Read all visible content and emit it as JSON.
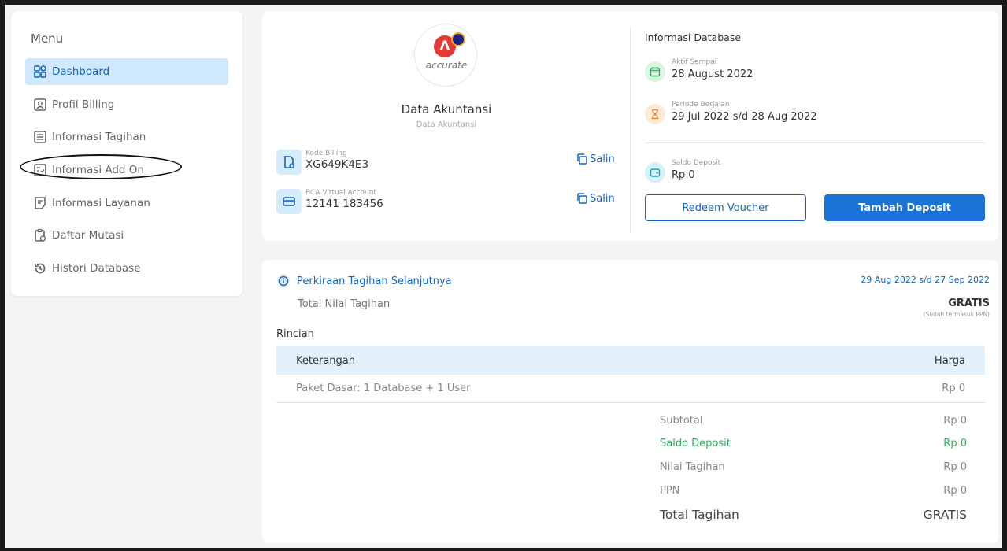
{
  "sidebar": {
    "title": "Menu",
    "items": [
      {
        "label": "Dashboard"
      },
      {
        "label": "Profil Billing"
      },
      {
        "label": "Informasi Tagihan"
      },
      {
        "label": "Informasi Add On"
      },
      {
        "label": "Informasi Layanan"
      },
      {
        "label": "Daftar Mutasi"
      },
      {
        "label": "Histori Database"
      }
    ]
  },
  "database": {
    "logo_text": "accurate",
    "name": "Data Akuntansi",
    "subtitle": "Data Akuntansi",
    "billing_code_label": "Kode Billing",
    "billing_code": "XG649K4E3",
    "va_label": "BCA Virtual Account",
    "va_number": "12141 183456",
    "copy_label": "Salin"
  },
  "db_info": {
    "title": "Informasi Database",
    "active_until_label": "Aktif Sampai",
    "active_until": "28 August 2022",
    "period_label": "Periode Berjalan",
    "period": "29 Jul 2022 s/d 28 Aug 2022",
    "deposit_label": "Saldo Deposit",
    "deposit": "Rp 0",
    "redeem_label": "Redeem Voucher",
    "topup_label": "Tambah Deposit"
  },
  "estimate": {
    "title": "Perkiraan Tagihan Selanjutnya",
    "period": "29 Aug 2022 s/d 27 Sep 2022",
    "total_label": "Total Nilai Tagihan",
    "total_value": "GRATIS",
    "total_note": "(Sudah termasuk PPN)",
    "details_label": "Rincian",
    "table": {
      "headers": [
        "Keterangan",
        "Harga"
      ],
      "rows": [
        [
          "Paket Dasar: 1 Database + 1 User",
          "Rp 0"
        ]
      ]
    },
    "summary": {
      "subtotal_label": "Subtotal",
      "subtotal": "Rp 0",
      "deposit_label": "Saldo Deposit",
      "deposit": "Rp 0",
      "bill_label": "Nilai Tagihan",
      "bill": "Rp 0",
      "ppn_label": "PPN",
      "ppn": "Rp 0",
      "total_label": "Total Tagihan",
      "total": "GRATIS"
    }
  },
  "colors": {
    "accent": "#1a73d9",
    "active_bg": "#cfe8fb",
    "green": "#2eaf5f"
  }
}
